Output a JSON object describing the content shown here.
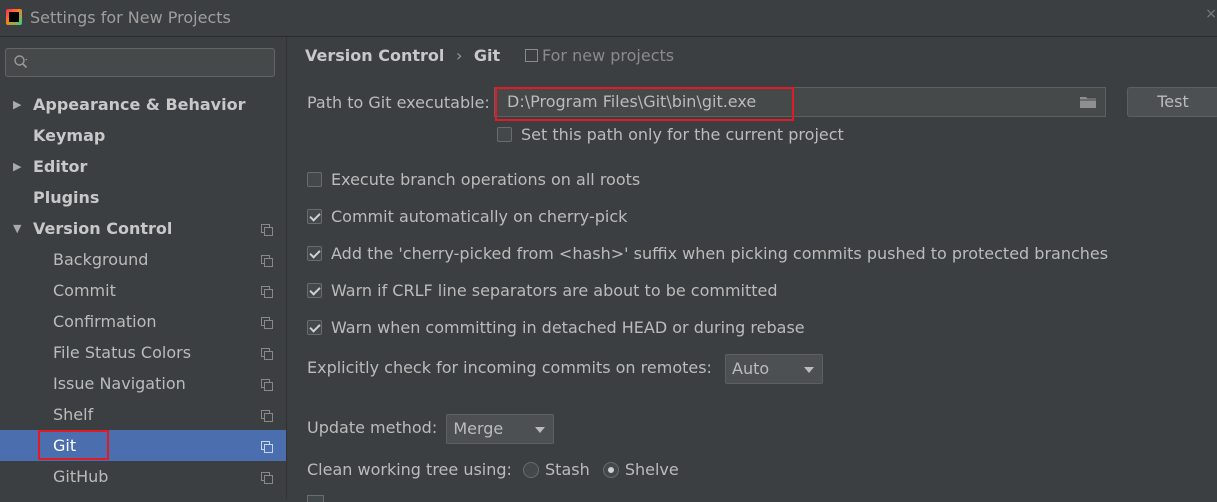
{
  "window": {
    "title": "Settings for New Projects"
  },
  "sidebar": {
    "search_placeholder": "",
    "items": [
      {
        "label": "Appearance & Behavior",
        "level": 0,
        "expandable": true,
        "expanded": false
      },
      {
        "label": "Keymap",
        "level": 0
      },
      {
        "label": "Editor",
        "level": 0,
        "expandable": true,
        "expanded": false
      },
      {
        "label": "Plugins",
        "level": 0
      },
      {
        "label": "Version Control",
        "level": 0,
        "expandable": true,
        "expanded": true
      },
      {
        "label": "Background",
        "level": 1
      },
      {
        "label": "Commit",
        "level": 1
      },
      {
        "label": "Confirmation",
        "level": 1
      },
      {
        "label": "File Status Colors",
        "level": 1
      },
      {
        "label": "Issue Navigation",
        "level": 1
      },
      {
        "label": "Shelf",
        "level": 1
      },
      {
        "label": "Git",
        "level": 1,
        "selected": true
      },
      {
        "label": "GitHub",
        "level": 1
      }
    ]
  },
  "main": {
    "breadcrumb": [
      "Version Control",
      "Git"
    ],
    "breadcrumb_sep": "›",
    "scope_note": "For new projects",
    "path_label": "Path to Git executable:",
    "path_value": "D:\\Program Files\\Git\\bin\\git.exe",
    "test_label": "Test",
    "current_project_only": {
      "label": "Set this path only for the current project",
      "checked": false
    },
    "options": [
      {
        "label": "Execute branch operations on all roots",
        "checked": false
      },
      {
        "label": "Commit automatically on cherry-pick",
        "checked": true
      },
      {
        "label": "Add the 'cherry-picked from <hash>' suffix when picking commits pushed to protected branches",
        "checked": true
      },
      {
        "label": "Warn if CRLF line separators are about to be committed",
        "checked": true
      },
      {
        "label": "Warn when committing in detached HEAD or during rebase",
        "checked": true
      }
    ],
    "incoming_label": "Explicitly check for incoming commits on remotes:",
    "incoming_value": "Auto",
    "update_label": "Update method:",
    "update_value": "Merge",
    "clean_label": "Clean working tree using:",
    "clean_options": [
      {
        "label": "Stash",
        "checked": false
      },
      {
        "label": "Shelve",
        "checked": true
      }
    ]
  },
  "colors": {
    "background": "#3c3f41",
    "selection": "#4b6eaf",
    "highlight_box": "#e01b24"
  }
}
